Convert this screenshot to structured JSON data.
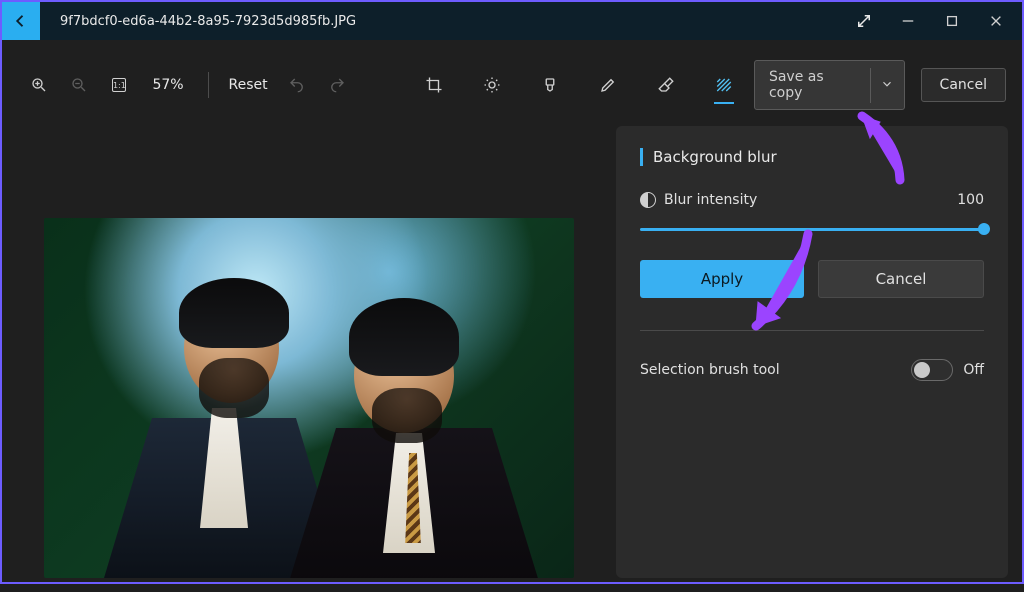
{
  "title": "9f7bdcf0-ed6a-44b2-8a95-7923d5d985fb.JPG",
  "toolbar": {
    "zoom_pct": "57%",
    "reset_label": "Reset",
    "one_to_one_label": "1:1",
    "save_label": "Save as copy",
    "cancel_label": "Cancel"
  },
  "panel": {
    "title": "Background blur",
    "intensity_label": "Blur intensity",
    "intensity_value": "100",
    "apply_label": "Apply",
    "panel_cancel_label": "Cancel",
    "brush_label": "Selection brush tool",
    "toggle_state": "Off"
  },
  "colors": {
    "accent": "#39b0f2",
    "callout": "#9b44ff"
  }
}
